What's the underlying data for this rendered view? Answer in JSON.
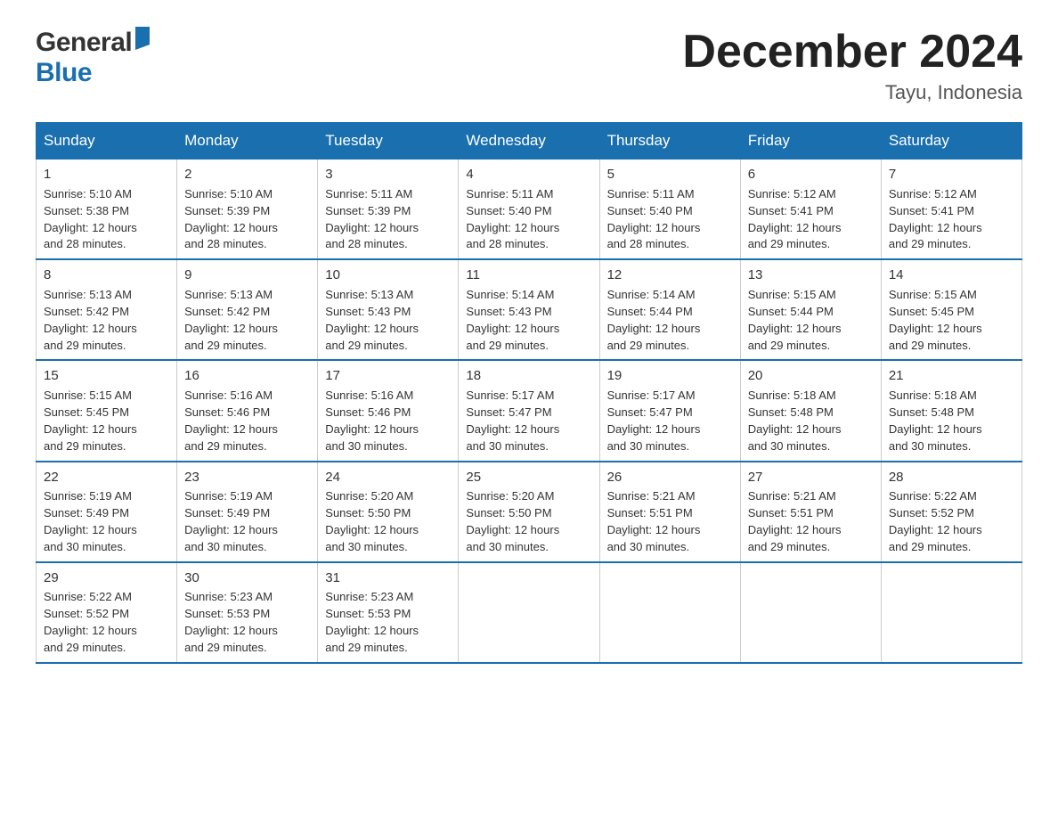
{
  "header": {
    "logo_general": "General",
    "logo_blue": "Blue",
    "month_title": "December 2024",
    "location": "Tayu, Indonesia"
  },
  "days_of_week": [
    "Sunday",
    "Monday",
    "Tuesday",
    "Wednesday",
    "Thursday",
    "Friday",
    "Saturday"
  ],
  "weeks": [
    [
      {
        "day": "1",
        "sunrise": "5:10 AM",
        "sunset": "5:38 PM",
        "daylight": "12 hours and 28 minutes."
      },
      {
        "day": "2",
        "sunrise": "5:10 AM",
        "sunset": "5:39 PM",
        "daylight": "12 hours and 28 minutes."
      },
      {
        "day": "3",
        "sunrise": "5:11 AM",
        "sunset": "5:39 PM",
        "daylight": "12 hours and 28 minutes."
      },
      {
        "day": "4",
        "sunrise": "5:11 AM",
        "sunset": "5:40 PM",
        "daylight": "12 hours and 28 minutes."
      },
      {
        "day": "5",
        "sunrise": "5:11 AM",
        "sunset": "5:40 PM",
        "daylight": "12 hours and 28 minutes."
      },
      {
        "day": "6",
        "sunrise": "5:12 AM",
        "sunset": "5:41 PM",
        "daylight": "12 hours and 29 minutes."
      },
      {
        "day": "7",
        "sunrise": "5:12 AM",
        "sunset": "5:41 PM",
        "daylight": "12 hours and 29 minutes."
      }
    ],
    [
      {
        "day": "8",
        "sunrise": "5:13 AM",
        "sunset": "5:42 PM",
        "daylight": "12 hours and 29 minutes."
      },
      {
        "day": "9",
        "sunrise": "5:13 AM",
        "sunset": "5:42 PM",
        "daylight": "12 hours and 29 minutes."
      },
      {
        "day": "10",
        "sunrise": "5:13 AM",
        "sunset": "5:43 PM",
        "daylight": "12 hours and 29 minutes."
      },
      {
        "day": "11",
        "sunrise": "5:14 AM",
        "sunset": "5:43 PM",
        "daylight": "12 hours and 29 minutes."
      },
      {
        "day": "12",
        "sunrise": "5:14 AM",
        "sunset": "5:44 PM",
        "daylight": "12 hours and 29 minutes."
      },
      {
        "day": "13",
        "sunrise": "5:15 AM",
        "sunset": "5:44 PM",
        "daylight": "12 hours and 29 minutes."
      },
      {
        "day": "14",
        "sunrise": "5:15 AM",
        "sunset": "5:45 PM",
        "daylight": "12 hours and 29 minutes."
      }
    ],
    [
      {
        "day": "15",
        "sunrise": "5:15 AM",
        "sunset": "5:45 PM",
        "daylight": "12 hours and 29 minutes."
      },
      {
        "day": "16",
        "sunrise": "5:16 AM",
        "sunset": "5:46 PM",
        "daylight": "12 hours and 29 minutes."
      },
      {
        "day": "17",
        "sunrise": "5:16 AM",
        "sunset": "5:46 PM",
        "daylight": "12 hours and 30 minutes."
      },
      {
        "day": "18",
        "sunrise": "5:17 AM",
        "sunset": "5:47 PM",
        "daylight": "12 hours and 30 minutes."
      },
      {
        "day": "19",
        "sunrise": "5:17 AM",
        "sunset": "5:47 PM",
        "daylight": "12 hours and 30 minutes."
      },
      {
        "day": "20",
        "sunrise": "5:18 AM",
        "sunset": "5:48 PM",
        "daylight": "12 hours and 30 minutes."
      },
      {
        "day": "21",
        "sunrise": "5:18 AM",
        "sunset": "5:48 PM",
        "daylight": "12 hours and 30 minutes."
      }
    ],
    [
      {
        "day": "22",
        "sunrise": "5:19 AM",
        "sunset": "5:49 PM",
        "daylight": "12 hours and 30 minutes."
      },
      {
        "day": "23",
        "sunrise": "5:19 AM",
        "sunset": "5:49 PM",
        "daylight": "12 hours and 30 minutes."
      },
      {
        "day": "24",
        "sunrise": "5:20 AM",
        "sunset": "5:50 PM",
        "daylight": "12 hours and 30 minutes."
      },
      {
        "day": "25",
        "sunrise": "5:20 AM",
        "sunset": "5:50 PM",
        "daylight": "12 hours and 30 minutes."
      },
      {
        "day": "26",
        "sunrise": "5:21 AM",
        "sunset": "5:51 PM",
        "daylight": "12 hours and 30 minutes."
      },
      {
        "day": "27",
        "sunrise": "5:21 AM",
        "sunset": "5:51 PM",
        "daylight": "12 hours and 29 minutes."
      },
      {
        "day": "28",
        "sunrise": "5:22 AM",
        "sunset": "5:52 PM",
        "daylight": "12 hours and 29 minutes."
      }
    ],
    [
      {
        "day": "29",
        "sunrise": "5:22 AM",
        "sunset": "5:52 PM",
        "daylight": "12 hours and 29 minutes."
      },
      {
        "day": "30",
        "sunrise": "5:23 AM",
        "sunset": "5:53 PM",
        "daylight": "12 hours and 29 minutes."
      },
      {
        "day": "31",
        "sunrise": "5:23 AM",
        "sunset": "5:53 PM",
        "daylight": "12 hours and 29 minutes."
      },
      null,
      null,
      null,
      null
    ]
  ],
  "labels": {
    "sunrise": "Sunrise:",
    "sunset": "Sunset:",
    "daylight": "Daylight:"
  }
}
